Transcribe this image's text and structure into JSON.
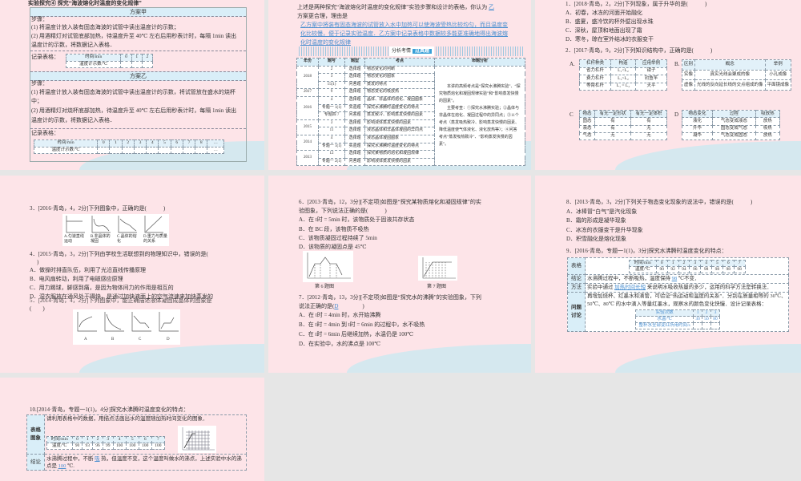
{
  "s1": {
    "title": "实验探究④ 探究“海波熔化时温度的变化规律”",
    "plan_a": {
      "header": "方案甲",
      "steps_label": "步骤：",
      "step1": "(1) 将温度计放入装有固态海波的试管中读出温度计的示数；",
      "step2": "(2) 用酒精灯对试管底部加热，待温度升至 40℃ 左右后用秒表计时，每隔 1min 读出",
      "step2b": "温度计的示数，将数据记入表格．",
      "record_label": "记录表格：",
      "table": [
        [
          "时间/min",
          "0",
          "1",
          "2"
        ],
        [
          "温度计示数/℃",
          "",
          "",
          ""
        ]
      ]
    },
    "plan_b": {
      "header": "方案乙",
      "steps_label": "步骤：",
      "step1": "(1) 将温度计放入装有固态海波的试管中读出温度计的示数，将试管放在盛水的烧杯",
      "step1b": "中；",
      "step2": "(2) 用酒精灯对烧杯底部加热，待温度升至 40℃ 左右后用秒表计时，每隔 1min 读出",
      "step2b": "温度计的示数，将数据记入表格．",
      "record_label": "记录表格：",
      "table": [
        [
          "时间/min",
          "0",
          "1",
          "2",
          "3",
          "4",
          "5",
          "6",
          "7",
          "8",
          "…"
        ],
        [
          "温度计示数/℃",
          "",
          "",
          "",
          "",
          "",
          "",
          "",
          "",
          "",
          "…"
        ]
      ]
    }
  },
  "s2": {
    "line1": "上述是两种探究“海波熔化时温度的变化规律”实验步骤和设计的表格，你认为",
    "answer1": "乙",
    "line2": "方案更合理，理由是",
    "reason": [
      "乙方案中将装有固态海波的试管放入水中加热可以使海波受热比较均匀，而且温度变",
      "化比较慢，便于记录实验温度．乙方案中记录表格中数据较多能更准确地得出海波熔",
      "化时温度的变化规律"
    ],
    "banner": "分析考情",
    "badge": "过真题",
    "headers": [
      "年份",
      "题号",
      "题型",
      "考点",
      "命题分析"
    ],
    "years": [
      "2018",
      "2017",
      "2016",
      "2015",
      "2014",
      "2013"
    ],
    "rows": [
      [
        "2",
        "选择题",
        "物态变化的判断"
      ],
      [
        "3",
        "选择题",
        "物态变化的图象"
      ],
      [
        "15(1)",
        "问答题",
        "蒸发的特点"
      ],
      [
        "9",
        "选择题",
        "物态变化的吸放热"
      ],
      [
        "4",
        "选择题",
        "晶体、非晶体的熔化、凝固图象"
      ],
      [
        "专题一 1(1)",
        "实验题",
        "探究水沸腾时温度变化的特点"
      ],
      [
        "专题四 7",
        "问答题",
        "蒸发致冷、影响蒸发快慢的因素"
      ],
      [
        "3",
        "选择题",
        "影响液体蒸发快慢的因素"
      ],
      [
        "11",
        "选择题",
        "液态晶体和非晶体凝固的异同点"
      ],
      [
        "4",
        "选择题",
        "液态晶体凝固图象"
      ],
      [
        "专题一 1(1)",
        "实验题",
        "探究水沸腾时温度变化的特点"
      ],
      [
        "12",
        "选择题",
        "探究某物质的熔化和凝固规律"
      ],
      [
        "专题一 2(1)",
        "问答题",
        "影响液体蒸发快慢的因素"
      ]
    ],
    "analysis": [
      "本讲的高频考点是“探究水沸腾实验”、“探究物质熔化和凝固规律实验”和“影响蒸发快慢的因素”。",
      "主要考查：①探究水沸腾实验；②晶体与非晶体在熔化、凝固过程中的异同点；③11个考点（蒸发吸热致冷、影响蒸发快慢的因素、降低温度使气体液化、液化放热等）；④问答考点“蒸发吸热致冷”、“影响蒸发快慢的因素”。"
    ]
  },
  "s3": {
    "q1": "1．[2018·青岛，2，2分]下列现象，属于升华的是(　　　)",
    "q1_options": [
      "A．初春，冰冻的河面开始融化",
      "B．盛夏，盛冷饮的杯外壁出现水珠",
      "C．深秋，屋顶和地面出现了霜",
      "D．寒冬，晾在室外结冰的衣服变干"
    ],
    "q2": "2．[2017·青岛，9，2分]下列知识结构中，正确的是(　　　)",
    "labels": [
      "A.",
      "B.",
      "C",
      "D"
    ],
    "tableA": [
      [
        "杠杆种类",
        "构造",
        "应用举例"
      ],
      [
        "省力杠杆",
        "L₁<L₂",
        "钳子"
      ],
      [
        "费力杠杆",
        "L₁>L₂",
        "钓鱼竿"
      ],
      [
        "等臂杠杆",
        "L₁ = L₂",
        "天平"
      ]
    ],
    "tableB": [
      [
        "区别",
        "概念",
        "举例"
      ],
      [
        "实像",
        "真实光线会聚成的像",
        "小孔成像"
      ],
      [
        "虚像",
        "光线的反向延长线的交点组成的像",
        "平面镜成像"
      ]
    ],
    "tableC": [
      [
        "物态",
        "有无一定形状",
        "有无一定体积"
      ],
      [
        "固态",
        "有",
        "有"
      ],
      [
        "液态",
        "有",
        "无"
      ],
      [
        "气态",
        "无",
        "无"
      ]
    ],
    "tableD": [
      [
        "物态变化",
        "过程",
        "吸放热"
      ],
      [
        "液化",
        "气态变成液态",
        "放热"
      ],
      [
        "升华",
        "固态变成气态",
        "吸热"
      ],
      [
        "凝华",
        "气态变成固态",
        "放热"
      ]
    ]
  },
  "s4": {
    "q3": "3．[2016·青岛，4，2分]下列图象中，正确的是(　　　)",
    "q3_captions": [
      "A.匀速直线运动",
      "B.非晶体的凝固",
      "C.晶体的熔化",
      "D.重力与质量的关系"
    ],
    "q4": "4．[2015·青岛，3，2分]下列由学校生活联想到的物理知识中，错误的是(",
    "q4_close": ")",
    "q4_options": [
      "A．做操时排直队伍，利用了光沿直线传播原理",
      "B．电风扇转动，利用了电磁感应原理",
      "C．用力踢球，脚感到痛，是因为物体间力的作用是相互的",
      "D．湿衣服放在通风处干得快，是通过加快液面上的空气流速来加快蒸发的"
    ],
    "q5": "5．[2014·青岛，4，2分]下列图象中，能正确描述液体凝固成晶体的图象是",
    "q5_paren": "(　　)",
    "q5_labels": [
      "A",
      "B",
      "C",
      "D"
    ]
  },
  "s5": {
    "q6": "6．[2013·青岛，12，3分][不定项]如图是“探究某物质熔化和凝固规律”的实",
    "q6b": "验图象，下列说法正确的是(　　　)",
    "q6_options": [
      "A．在 t时 = 5min 时，该物质处于固液共存状态",
      "B．在 BC 段，该物质不吸热",
      "C．该物质凝固过程持续了 5min",
      "D．该物质的凝固点是 45℃"
    ],
    "cap6": "第 6 题图",
    "cap7": "第 7 题图",
    "q7": "7．[2012·青岛，13，3分][不定项]如图是“探究水的沸腾”的实验图象，下列",
    "q7b": "说法正确的是(",
    "q7_answer": "D",
    "q7_close": ")",
    "q7_options": [
      "A．在 t时 = 4min 时，水开始沸腾",
      "B．在 t时 = 4min 到 t时 = 6min 的过程中，水不吸热",
      "C．在 t时 = 6min 后继续加热，水温仍是 100℃",
      "D．在实验中，水的沸点是 100℃"
    ]
  },
  "s6": {
    "q8": "8．[2013·青岛，3，2分]下列关于物态变化现象的说法中，错误的是(　　　)",
    "q8_options": [
      "A．冰棒冒“白气”是汽化现象",
      "B．霜的形成是凝华现象",
      "C．冰冻的衣服变干是升华现象",
      "D．积雪融化是熔化现象"
    ],
    "q9": "9．[2016·青岛，专题一1(1)，3分]探究水沸腾时温度变化的特点：",
    "labels": {
      "table": "表格",
      "conclusion": "结论",
      "method": "方法",
      "discussion": "问题讨论"
    },
    "table": [
      [
        "时间/min",
        "0",
        "1",
        "2",
        "3",
        "4",
        "5",
        "6",
        "7"
      ],
      [
        "温度/℃",
        "90",
        "92",
        "94",
        "96",
        "98",
        "98",
        "98",
        "98"
      ]
    ],
    "conclusion": {
      "pre": "水沸腾过程中，不断吸热，温度保持",
      "answer": "98",
      "post": "℃不变．"
    },
    "method": {
      "pre": "实验中通过",
      "answer": "加热时间长短",
      "post": "来说明水吸收热量的多少，运用的科学方法是转换法．"
    },
    "discussion": "再增加烧杯、红墨水和滴管，可验证“热运动和温度的关系”．分别在质量相等的 30℃、50℃、80℃ 的水中滴入等量红墨水，观察水的颜色变化快慢．设计记录表格：",
    "record_table": [
      [
        "实验次数",
        "1",
        "2",
        "3"
      ],
      [
        "水温/℃",
        "30",
        "50",
        "80"
      ],
      [
        "整杯水全部变红所用时间/s",
        "",
        "",
        ""
      ]
    ]
  },
  "s7": {
    "q10": "10.[2014·青岛，专题一1(1)，4分]探究水沸腾时温度变化的特点：",
    "labels": {
      "table": "表格图象",
      "conclusion": "结论"
    },
    "instruction": "请利用表格中的数据，用描点法画出水的温度随加热时间变化的图象．",
    "table": [
      [
        "时间/min",
        "0",
        "1",
        "2",
        "3",
        "4",
        "5",
        "6",
        "7"
      ],
      [
        "温度/℃",
        "90",
        "93",
        "96",
        "99",
        "100",
        "100",
        "100",
        "100"
      ]
    ],
    "conclusion": {
      "pre": "水沸腾过程中，不断",
      "answer1": "吸",
      "mid": "热，但温度不变，这个温度叫做水的沸点，上述实验中水的沸点是",
      "answer2": "100",
      "post": "℃."
    }
  }
}
